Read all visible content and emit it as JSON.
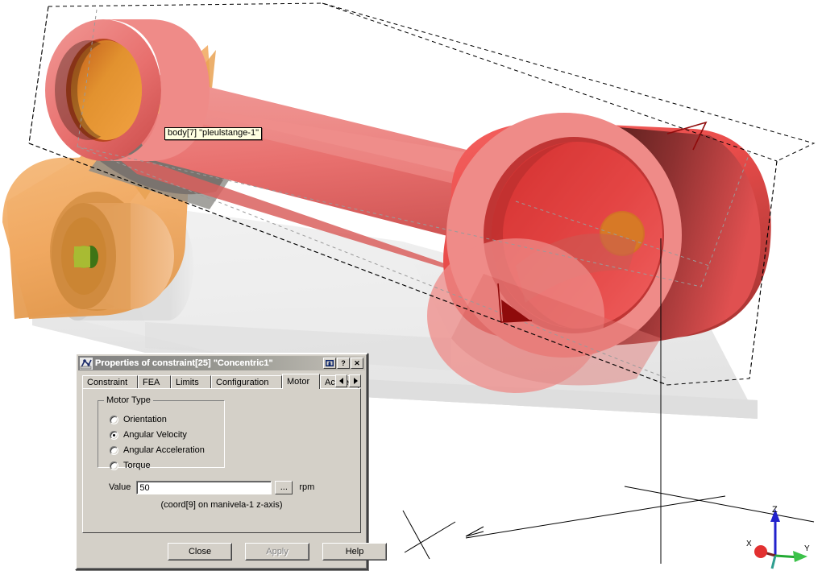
{
  "viewport": {
    "name": "3d-model-viewport",
    "background": "#ffffff",
    "selected_body_tooltip": "body[7] \"pleulstange-1\"",
    "axis_triad": {
      "z_label": "Z",
      "y_label": "Y",
      "x_label": "X",
      "z_color": "#2222cc",
      "y_color": "#22bb33",
      "x_color": "#dd2222"
    },
    "colors": {
      "connecting_rod": "#e8706e",
      "connecting_rod_light": "#ee8f8c",
      "connecting_rod_dark": "#d33c3a",
      "crank": "#f0a860",
      "crank_dark": "#d8872f",
      "base_plate": "#e6e6e6",
      "pin_green": "#6f9f25",
      "hole_orange": "#e08b2a",
      "marker_red": "#aa1111"
    }
  },
  "dialog": {
    "title": "Properties of constraint[25] \"Concentric1\"",
    "title_icon": "mechanism-icon",
    "titlebar_buttons": [
      {
        "name": "restore-button",
        "glyph": "❐"
      },
      {
        "name": "help-button",
        "glyph": "?"
      },
      {
        "name": "close-button",
        "glyph": "✕"
      }
    ],
    "tabs": [
      {
        "label": "Constraint",
        "active": false
      },
      {
        "label": "FEA",
        "active": false
      },
      {
        "label": "Limits",
        "active": false
      },
      {
        "label": "Configuration",
        "active": false
      },
      {
        "label": "Motor",
        "active": true
      },
      {
        "label": "Active",
        "active": false
      }
    ],
    "tab_scroll": {
      "left": "◄",
      "right": "►"
    },
    "motor_tab": {
      "group_title": "Motor Type",
      "options": [
        {
          "label": "Orientation",
          "selected": false
        },
        {
          "label": "Angular Velocity",
          "selected": true
        },
        {
          "label": "Angular Acceleration",
          "selected": false
        },
        {
          "label": "Torque",
          "selected": false
        }
      ],
      "value_label": "Value",
      "value": "50",
      "value_placeholder": "",
      "browse_button": "...",
      "unit": "rpm",
      "coord_note": "(coord[9] on manivela-1 z-axis)"
    },
    "buttons": [
      {
        "label": "Close",
        "disabled": false
      },
      {
        "label": "Apply",
        "disabled": true
      },
      {
        "label": "Help",
        "disabled": false
      }
    ]
  }
}
